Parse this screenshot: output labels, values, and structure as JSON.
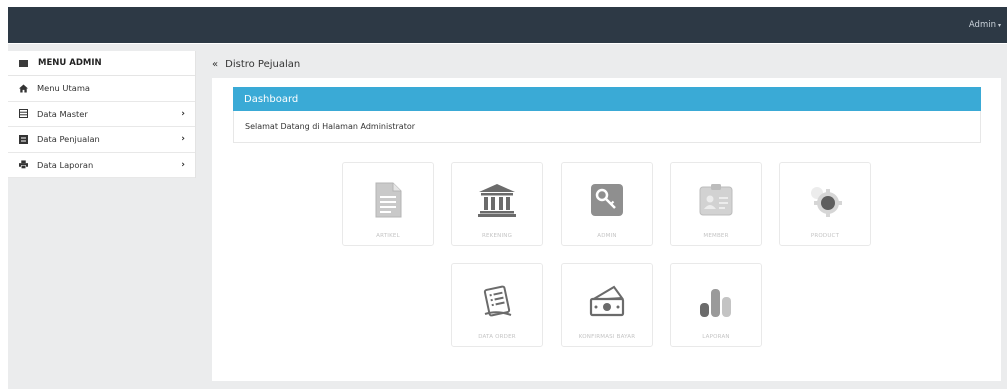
{
  "topbar": {
    "user_label": "Admin",
    "caret": "▾"
  },
  "sidebar": {
    "title": "MENU ADMIN",
    "items": [
      {
        "label": "Menu Utama",
        "icon": "home-icon",
        "has_submenu": false
      },
      {
        "label": "Data Master",
        "icon": "table-icon",
        "has_submenu": true
      },
      {
        "label": "Data Penjualan",
        "icon": "list-icon",
        "has_submenu": true
      },
      {
        "label": "Data Laporan",
        "icon": "print-icon",
        "has_submenu": true
      }
    ],
    "chevron": "›"
  },
  "breadcrumb": {
    "back_glyph": "«",
    "title": "Distro Pejualan"
  },
  "panel": {
    "heading": "Dashboard",
    "welcome": "Selamat Datang di Halaman Administrator"
  },
  "tiles": [
    {
      "label": "ARTIKEL",
      "icon": "document-icon"
    },
    {
      "label": "REKENING",
      "icon": "bank-icon"
    },
    {
      "label": "ADMIN",
      "icon": "key-icon"
    },
    {
      "label": "MEMBER",
      "icon": "id-card-icon"
    },
    {
      "label": "PRODUCT",
      "icon": "gear-icon"
    },
    {
      "label": "DATA ORDER",
      "icon": "order-pad-icon"
    },
    {
      "label": "KONFIRMASI BAYAR",
      "icon": "money-icon"
    },
    {
      "label": "LAPORAN",
      "icon": "bar-chart-icon"
    }
  ],
  "colors": {
    "topbar": "#2d3945",
    "accent": "#3aaad6",
    "background": "#ebeced",
    "tile_icon": "#bdbdbd"
  }
}
